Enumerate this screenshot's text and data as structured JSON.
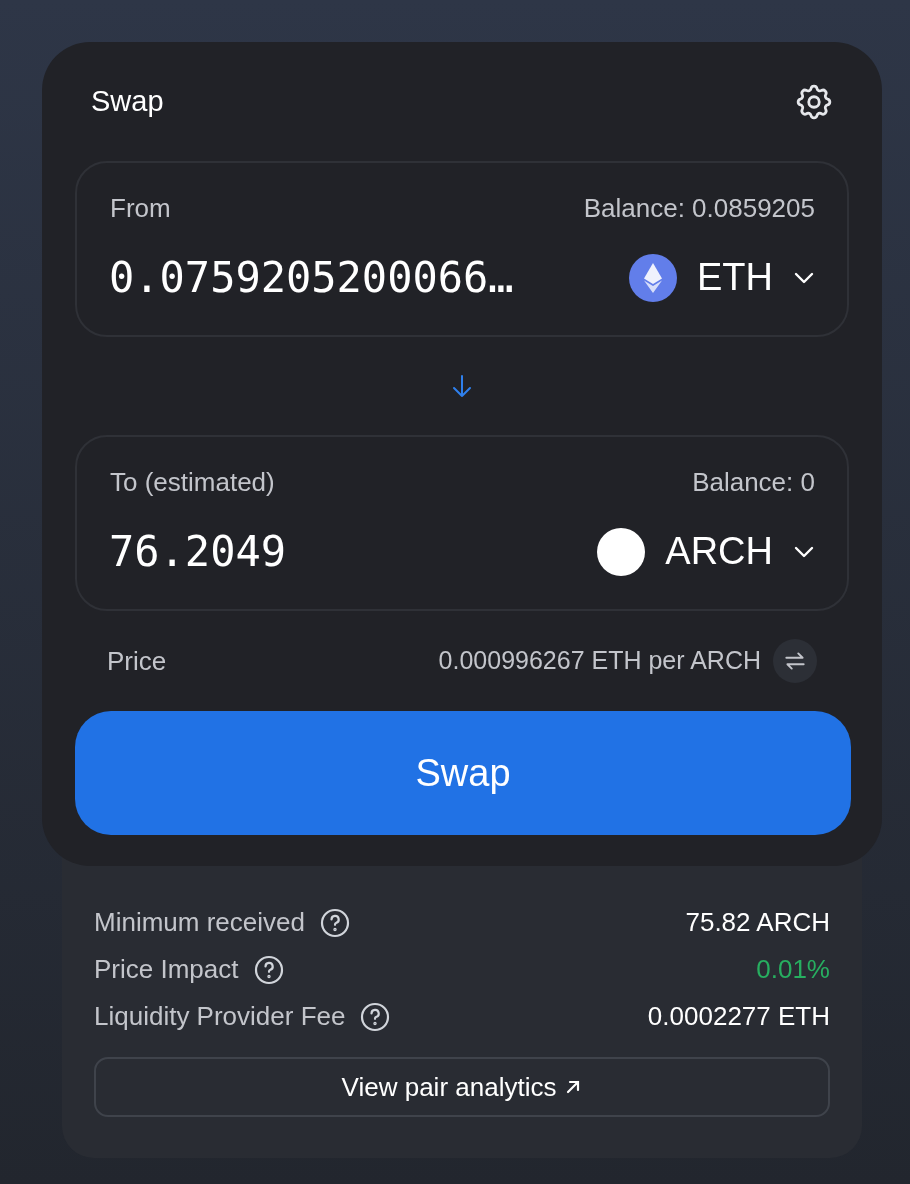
{
  "title": "Swap",
  "from": {
    "label": "From",
    "balance": "Balance: 0.0859205",
    "amount": "0.0759205200066…",
    "token": "ETH",
    "kind": "eth"
  },
  "to": {
    "label": "To (estimated)",
    "balance": "Balance: 0",
    "amount": "76.2049",
    "token": "ARCH",
    "kind": "plain"
  },
  "price": {
    "label": "Price",
    "value": "0.000996267 ETH per ARCH"
  },
  "swap_button": "Swap",
  "details": [
    {
      "label": "Minimum received",
      "value": "75.82 ARCH",
      "color": "#ffffff"
    },
    {
      "label": "Price Impact",
      "value": "0.01%",
      "color": "#27ae60"
    },
    {
      "label": "Liquidity Provider Fee",
      "value": "0.0002277 ETH",
      "color": "#ffffff"
    }
  ],
  "analytics_link": "View pair analytics"
}
